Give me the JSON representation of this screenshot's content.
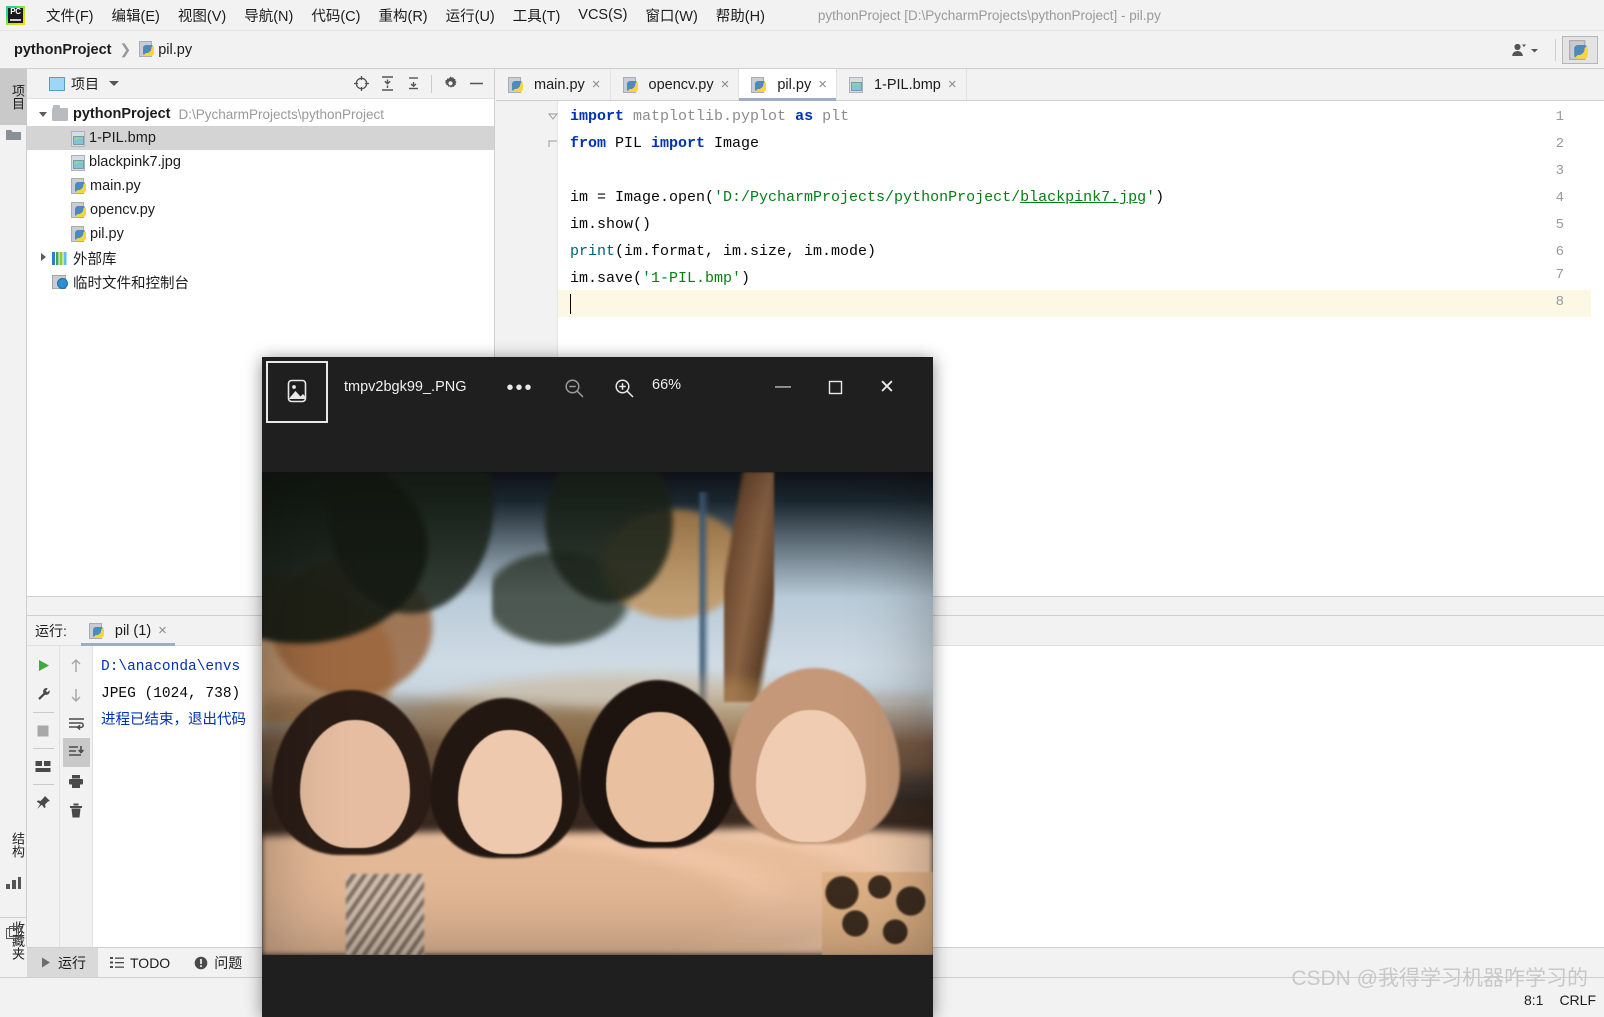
{
  "window": {
    "title": "pythonProject [D:\\PycharmProjects\\pythonProject] - pil.py",
    "app_icon": "pycharm-logo-icon",
    "logo_text": "PC"
  },
  "menubar": {
    "items": [
      {
        "label": "文件(F)",
        "key": "F"
      },
      {
        "label": "编辑(E)",
        "key": "E"
      },
      {
        "label": "视图(V)",
        "key": "V"
      },
      {
        "label": "导航(N)",
        "key": "N"
      },
      {
        "label": "代码(C)",
        "key": "C"
      },
      {
        "label": "重构(R)",
        "key": "R"
      },
      {
        "label": "运行(U)",
        "key": "U"
      },
      {
        "label": "工具(T)",
        "key": "T"
      },
      {
        "label": "VCS(S)",
        "key": "S"
      },
      {
        "label": "窗口(W)",
        "key": "W"
      },
      {
        "label": "帮助(H)",
        "key": "H"
      }
    ]
  },
  "navbar": {
    "root": "pythonProject",
    "separator": "❯",
    "file": "pil.py",
    "avatar_icon": "user-account-icon",
    "run_config_icon": "python-config-icon"
  },
  "left_strip": {
    "tabs": [
      {
        "label": "项目",
        "active": true,
        "icon": "project-panel-icon"
      },
      {
        "label": "结构",
        "active": false,
        "icon": "structure-icon"
      },
      {
        "label": "收藏夹",
        "active": false,
        "icon": "favorites-star-icon"
      }
    ]
  },
  "project_panel": {
    "header_label": "项目",
    "tools": [
      "locate-target-icon",
      "expand-all-icon",
      "collapse-all-icon",
      "settings-gear-icon",
      "hide-panel-icon"
    ],
    "tree": [
      {
        "name": "pythonProject",
        "path": "D:\\PycharmProjects\\pythonProject",
        "type": "folder",
        "indent": 0,
        "expanded": true,
        "bold": true,
        "selected": false
      },
      {
        "name": "1-PIL.bmp",
        "path": "",
        "type": "image",
        "indent": 2,
        "expanded": null,
        "bold": false,
        "selected": true
      },
      {
        "name": "blackpink7.jpg",
        "path": "",
        "type": "image",
        "indent": 2,
        "expanded": null,
        "bold": false,
        "selected": false
      },
      {
        "name": "main.py",
        "path": "",
        "type": "python",
        "indent": 2,
        "expanded": null,
        "bold": false,
        "selected": false
      },
      {
        "name": "opencv.py",
        "path": "",
        "type": "python",
        "indent": 2,
        "expanded": null,
        "bold": false,
        "selected": false
      },
      {
        "name": "pil.py",
        "path": "",
        "type": "python",
        "indent": 2,
        "expanded": null,
        "bold": false,
        "selected": false
      },
      {
        "name": "外部库",
        "path": "",
        "type": "library",
        "indent": 1,
        "expanded": false,
        "bold": false,
        "selected": false
      },
      {
        "name": "临时文件和控制台",
        "path": "",
        "type": "scratch",
        "indent": 1,
        "expanded": null,
        "bold": false,
        "selected": false
      }
    ]
  },
  "editor": {
    "tabs": [
      {
        "label": "main.py",
        "icon": "python-file-icon",
        "active": false,
        "close": "×"
      },
      {
        "label": "opencv.py",
        "icon": "python-file-icon",
        "active": false,
        "close": "×"
      },
      {
        "label": "pil.py",
        "icon": "python-file-icon",
        "active": true,
        "close": "×"
      },
      {
        "label": "1-PIL.bmp",
        "icon": "image-file-icon",
        "active": false,
        "close": "×"
      }
    ],
    "line_numbers": [
      "1",
      "2",
      "3",
      "4",
      "5",
      "6",
      "7",
      "8"
    ],
    "current_line": 8,
    "code_lines": [
      "import matplotlib.pyplot as plt",
      "from PIL import Image",
      "",
      "im = Image.open('D:/PycharmProjects/pythonProject/blackpink7.jpg')",
      "im.show()",
      "print(im.format, im.size, im.mode)",
      "im.save('1-PIL.bmp')",
      ""
    ]
  },
  "run_panel": {
    "label": "运行:",
    "tab_label": "pil (1)",
    "tab_icon": "python-run-icon",
    "tab_close": "×",
    "left_buttons": [
      "rerun-play-icon",
      "settings-wrench-icon",
      "stop-icon",
      "layout-icon",
      "pin-tab-icon"
    ],
    "right_buttons": [
      "scroll-up-icon",
      "scroll-down-icon",
      "soft-wrap-icon",
      "scroll-to-end-icon",
      "print-icon",
      "clear-all-trash-icon"
    ],
    "output_lines": [
      {
        "text": "D:\\anaconda\\envs",
        "style": "path"
      },
      {
        "text": "JPEG (1024, 738)",
        "style": "output"
      },
      {
        "text": "",
        "style": "output"
      },
      {
        "text": "进程已结束，退出代码",
        "style": "path"
      }
    ]
  },
  "toolwindow_bar": {
    "items": [
      {
        "label": "运行",
        "icon": "run-play-icon",
        "active": true
      },
      {
        "label": "TODO",
        "icon": "todo-list-icon",
        "active": false
      },
      {
        "label": "问题",
        "icon": "problems-warning-icon",
        "active": false
      },
      {
        "label": "",
        "icon": "terminal-icon",
        "active": false
      }
    ]
  },
  "statusbar": {
    "caret_position": "8:1",
    "line_separator": "CRLF",
    "watermark": "CSDN @我得学习机器咋学习的"
  },
  "photo_viewer": {
    "title": "tmpv2bgk99_.PNG",
    "app_icon": "photos-app-icon",
    "zoom_level": "66%",
    "more_label": "•••",
    "zoom_out_icon": "zoom-out-magnifier-icon",
    "zoom_in_icon": "zoom-in-magnifier-icon",
    "minimize_label": "—",
    "maximize_label": "▢",
    "close_label": "✕",
    "image_description": "Four-person group photo outdoors with palm trees and blue sky"
  },
  "colors": {
    "accent_tab": "#9fadc4",
    "keyword": "#0033b3",
    "string": "#067d17",
    "function": "#00627a",
    "module": "#8c8c8c",
    "current_line": "#fdf8e3",
    "selection": "#d4d4d4",
    "viewer_chrome": "#1f1f1f"
  }
}
